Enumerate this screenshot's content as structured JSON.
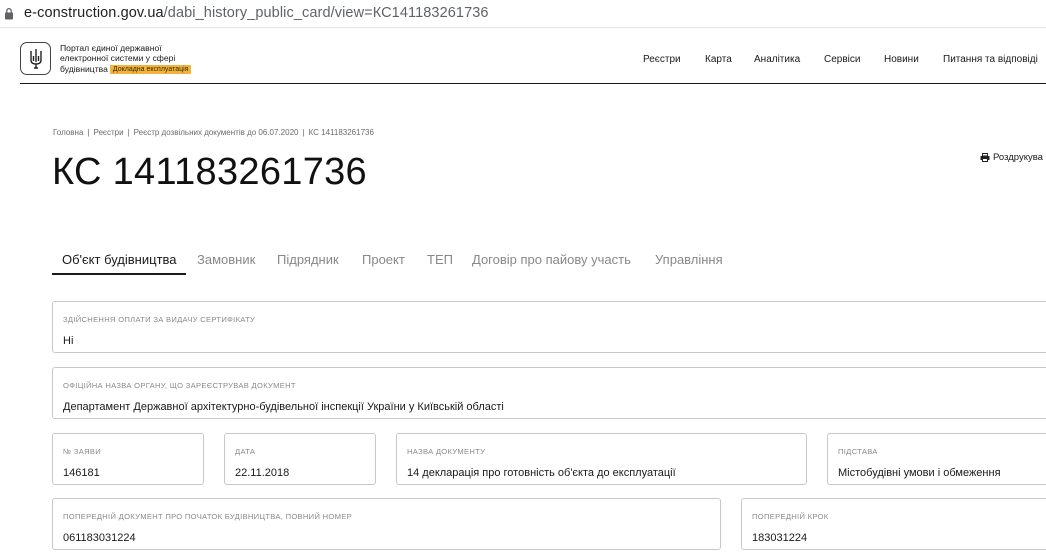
{
  "browser": {
    "url_domain": "e-construction.gov.ua",
    "url_path": "/dabi_history_public_card/view=КС141183261736"
  },
  "header": {
    "brand_line1": "Портал єдиної державної",
    "brand_line2": "електронної системи у сфері",
    "brand_line3": "будівництва",
    "badge": "Докладна експлуатація",
    "nav": [
      "Реєстри",
      "Карта",
      "Аналітика",
      "Сервіси",
      "Новини",
      "Питання та відповіді"
    ]
  },
  "breadcrumb": [
    "Головна",
    "Реєстри",
    "Реєстр дозвільних документів до 06.07.2020",
    "КС 141183261736"
  ],
  "page": {
    "title": "КС 141183261736",
    "print_label": "Роздрукува"
  },
  "tabs": [
    "Об'єкт будівництва",
    "Замовник",
    "Підрядник",
    "Проект",
    "ТЕП",
    "Договір про пайову участь",
    "Управління"
  ],
  "fields": {
    "payment": {
      "label": "Здійснення оплати за видачу сертифікату",
      "value": "Ні"
    },
    "authority": {
      "label": "Офіційна назва органу, що зареєстрував документ",
      "value": "Департамент Державної архітектурно-будівельної інспекції України у Київській області"
    },
    "app_no": {
      "label": "№ заяви",
      "value": "146181"
    },
    "date": {
      "label": "Дата",
      "value": "22.11.2018"
    },
    "doc_name": {
      "label": "Назва документу",
      "value": "14 декларація про готовність об'єкта до експлуатації"
    },
    "basis": {
      "label": "Підстава",
      "value": "Містобудівні умови і обмеження"
    },
    "prev_doc": {
      "label": "Попередній документ про початок будівництва, повний номер",
      "value": "061183031224"
    },
    "prev_step": {
      "label": "Попередній крок",
      "value": "183031224"
    }
  }
}
